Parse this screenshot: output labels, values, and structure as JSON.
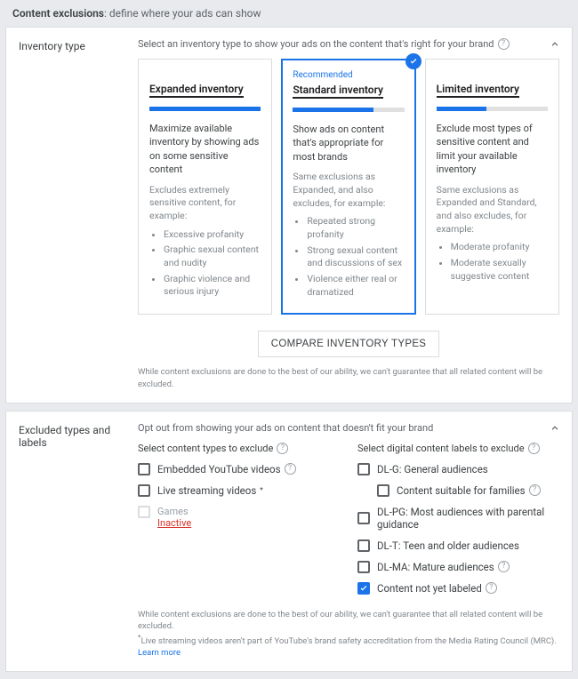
{
  "header": {
    "title": "Content exclusions",
    "subtitle": ": define where your ads can show"
  },
  "panel1": {
    "title": "Inventory type",
    "intro": "Select an inventory type to show your ads on the content that's right for your brand",
    "cards": {
      "expanded": {
        "title": "Expanded inventory",
        "desc": "Maximize available inventory by showing ads on some sensitive content",
        "sub_intro": "Excludes extremely sensitive content, for example:",
        "b1": "Excessive profanity",
        "b2": "Graphic sexual content and nudity",
        "b3": "Graphic violence and serious injury"
      },
      "standard": {
        "recommended": "Recommended",
        "title": "Standard inventory",
        "desc": "Show ads on content that's appropriate for most brands",
        "sub_intro": "Same exclusions as Expanded, and also excludes, for example:",
        "b1": "Repeated strong profanity",
        "b2": "Strong sexual content and discussions of sex",
        "b3": "Violence either real or dramatized"
      },
      "limited": {
        "title": "Limited inventory",
        "desc": "Exclude most types of sensitive content and limit your available inventory",
        "sub_intro": "Same exclusions as Expanded and Standard, and also excludes, for example:",
        "b1": "Moderate profanity",
        "b2": "Moderate sexually suggestive content"
      }
    },
    "compare_button": "COMPARE INVENTORY TYPES",
    "disclaimer": "While content exclusions are done to the best of our ability, we can't guarantee that all related content will be excluded."
  },
  "panel2": {
    "title": "Excluded types and labels",
    "intro": "Opt out from showing your ads on content that doesn't fit your brand",
    "left_head": "Select content types to exclude",
    "right_head": "Select digital content labels to exclude",
    "left": {
      "l1": "Embedded YouTube videos",
      "l2": "Live streaming videos",
      "l3_label": "Games",
      "l3_status": "Inactive"
    },
    "right": {
      "r1": "DL-G: General audiences",
      "r1a": "Content suitable for families",
      "r2": "DL-PG: Most audiences with parental guidance",
      "r3": "DL-T: Teen and older audiences",
      "r4": "DL-MA: Mature audiences",
      "r5": "Content not yet labeled"
    },
    "disclaimer1": "While content exclusions are done to the best of our ability, we can't guarantee that all related content will be excluded.",
    "disclaimer2": "Live streaming videos aren't part of YouTube's brand safety accreditation from the Media Rating Council (MRC).",
    "learn_more": "Learn more"
  }
}
